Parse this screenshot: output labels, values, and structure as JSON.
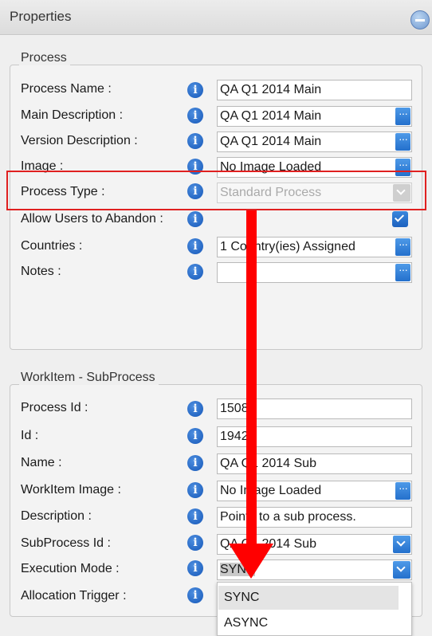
{
  "panel": {
    "title": "Properties"
  },
  "process": {
    "legend": "Process",
    "rows": {
      "process_name": {
        "label": "Process Name :",
        "value": "QA Q1 2014 Main"
      },
      "main_description": {
        "label": "Main Description :",
        "value": "QA Q1 2014 Main"
      },
      "version_description": {
        "label": "Version Description :",
        "value": "QA Q1 2014 Main"
      },
      "image": {
        "label": "Image :",
        "value": "No Image Loaded"
      },
      "process_type": {
        "label": "Process Type :",
        "value": "Standard Process"
      },
      "allow_abandon": {
        "label": "Allow Users to Abandon :",
        "checked": true
      },
      "countries": {
        "label": "Countries :",
        "value": "1 Country(ies) Assigned"
      },
      "notes": {
        "label": "Notes :",
        "value": ""
      }
    }
  },
  "workitem": {
    "legend": "WorkItem - SubProcess",
    "rows": {
      "process_id": {
        "label": "Process Id :",
        "value": "1508"
      },
      "id": {
        "label": "Id :",
        "value": "19425"
      },
      "name": {
        "label": "Name :",
        "value": "QA Q1 2014 Sub"
      },
      "workitem_image": {
        "label": "WorkItem Image :",
        "value": "No Image Loaded"
      },
      "description": {
        "label": "Description :",
        "value": "Points to a sub process."
      },
      "subprocess_id": {
        "label": "SubProcess Id :",
        "value": "QA Q1 2014 Sub"
      },
      "execution_mode": {
        "label": "Execution Mode :",
        "value": "SYNC"
      },
      "allocation_trigger": {
        "label": "Allocation Trigger :"
      }
    },
    "execution_mode_options": [
      "SYNC",
      "ASYNC"
    ]
  },
  "icons": {
    "info": "i"
  },
  "colors": {
    "accent": "#2470cc",
    "annotation": "#ff0000"
  }
}
